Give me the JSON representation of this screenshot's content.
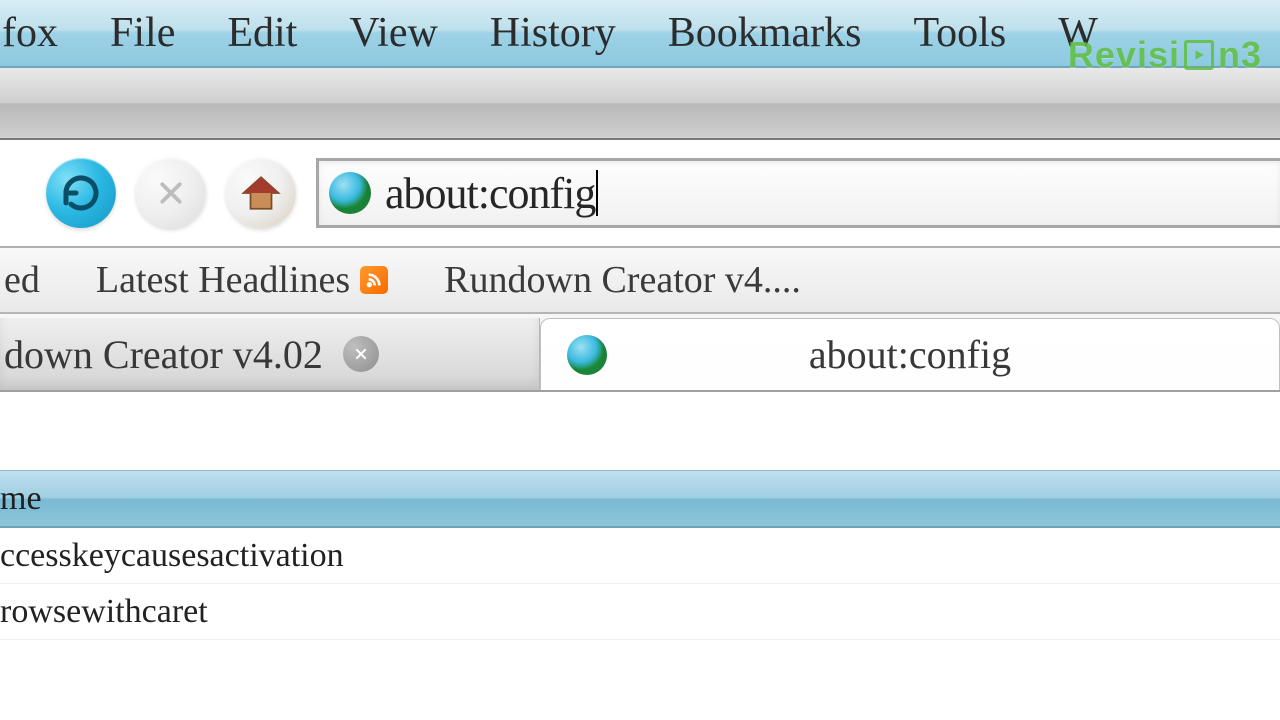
{
  "menubar": {
    "items": [
      "fox",
      "File",
      "Edit",
      "View",
      "History",
      "Bookmarks",
      "Tools",
      "W"
    ]
  },
  "nav": {
    "url": "about:config"
  },
  "bookmarks": {
    "items": [
      {
        "label": "ed"
      },
      {
        "label": "Latest Headlines"
      },
      {
        "label": "Rundown Creator v4...."
      }
    ]
  },
  "tabs": {
    "items": [
      {
        "label": "down Creator v4.02",
        "active": false
      },
      {
        "label": "about:config",
        "active": true
      }
    ]
  },
  "content": {
    "header": "me",
    "rows": [
      "ccesskeycausesactivation",
      "rowsewithcaret"
    ]
  },
  "watermark": {
    "text_a": "Revisi",
    "text_b": "n3"
  },
  "icons": {
    "reload": "reload-icon",
    "stop": "stop-icon",
    "home": "home-icon",
    "rss": "rss-icon",
    "site": "globe-icon",
    "close": "close-icon"
  }
}
